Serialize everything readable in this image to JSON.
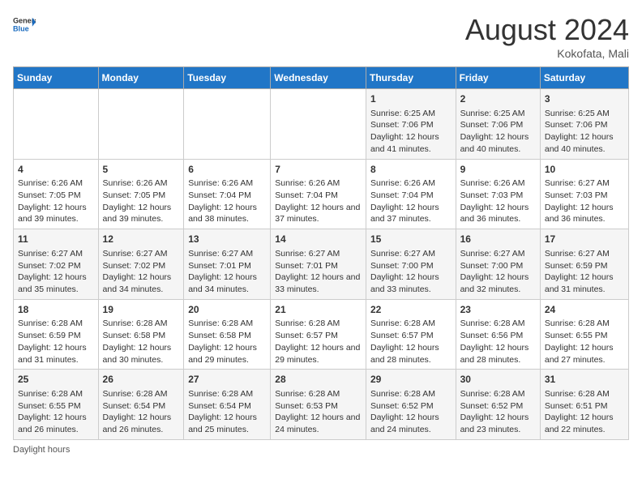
{
  "header": {
    "logo_general": "General",
    "logo_blue": "Blue",
    "month_title": "August 2024",
    "location": "Kokofata, Mali"
  },
  "days_of_week": [
    "Sunday",
    "Monday",
    "Tuesday",
    "Wednesday",
    "Thursday",
    "Friday",
    "Saturday"
  ],
  "weeks": [
    [
      {
        "day": "",
        "info": ""
      },
      {
        "day": "",
        "info": ""
      },
      {
        "day": "",
        "info": ""
      },
      {
        "day": "",
        "info": ""
      },
      {
        "day": "1",
        "info": "Sunrise: 6:25 AM\nSunset: 7:06 PM\nDaylight: 12 hours and 41 minutes."
      },
      {
        "day": "2",
        "info": "Sunrise: 6:25 AM\nSunset: 7:06 PM\nDaylight: 12 hours and 40 minutes."
      },
      {
        "day": "3",
        "info": "Sunrise: 6:25 AM\nSunset: 7:06 PM\nDaylight: 12 hours and 40 minutes."
      }
    ],
    [
      {
        "day": "4",
        "info": "Sunrise: 6:26 AM\nSunset: 7:05 PM\nDaylight: 12 hours and 39 minutes."
      },
      {
        "day": "5",
        "info": "Sunrise: 6:26 AM\nSunset: 7:05 PM\nDaylight: 12 hours and 39 minutes."
      },
      {
        "day": "6",
        "info": "Sunrise: 6:26 AM\nSunset: 7:04 PM\nDaylight: 12 hours and 38 minutes."
      },
      {
        "day": "7",
        "info": "Sunrise: 6:26 AM\nSunset: 7:04 PM\nDaylight: 12 hours and 37 minutes."
      },
      {
        "day": "8",
        "info": "Sunrise: 6:26 AM\nSunset: 7:04 PM\nDaylight: 12 hours and 37 minutes."
      },
      {
        "day": "9",
        "info": "Sunrise: 6:26 AM\nSunset: 7:03 PM\nDaylight: 12 hours and 36 minutes."
      },
      {
        "day": "10",
        "info": "Sunrise: 6:27 AM\nSunset: 7:03 PM\nDaylight: 12 hours and 36 minutes."
      }
    ],
    [
      {
        "day": "11",
        "info": "Sunrise: 6:27 AM\nSunset: 7:02 PM\nDaylight: 12 hours and 35 minutes."
      },
      {
        "day": "12",
        "info": "Sunrise: 6:27 AM\nSunset: 7:02 PM\nDaylight: 12 hours and 34 minutes."
      },
      {
        "day": "13",
        "info": "Sunrise: 6:27 AM\nSunset: 7:01 PM\nDaylight: 12 hours and 34 minutes."
      },
      {
        "day": "14",
        "info": "Sunrise: 6:27 AM\nSunset: 7:01 PM\nDaylight: 12 hours and 33 minutes."
      },
      {
        "day": "15",
        "info": "Sunrise: 6:27 AM\nSunset: 7:00 PM\nDaylight: 12 hours and 33 minutes."
      },
      {
        "day": "16",
        "info": "Sunrise: 6:27 AM\nSunset: 7:00 PM\nDaylight: 12 hours and 32 minutes."
      },
      {
        "day": "17",
        "info": "Sunrise: 6:27 AM\nSunset: 6:59 PM\nDaylight: 12 hours and 31 minutes."
      }
    ],
    [
      {
        "day": "18",
        "info": "Sunrise: 6:28 AM\nSunset: 6:59 PM\nDaylight: 12 hours and 31 minutes."
      },
      {
        "day": "19",
        "info": "Sunrise: 6:28 AM\nSunset: 6:58 PM\nDaylight: 12 hours and 30 minutes."
      },
      {
        "day": "20",
        "info": "Sunrise: 6:28 AM\nSunset: 6:58 PM\nDaylight: 12 hours and 29 minutes."
      },
      {
        "day": "21",
        "info": "Sunrise: 6:28 AM\nSunset: 6:57 PM\nDaylight: 12 hours and 29 minutes."
      },
      {
        "day": "22",
        "info": "Sunrise: 6:28 AM\nSunset: 6:57 PM\nDaylight: 12 hours and 28 minutes."
      },
      {
        "day": "23",
        "info": "Sunrise: 6:28 AM\nSunset: 6:56 PM\nDaylight: 12 hours and 28 minutes."
      },
      {
        "day": "24",
        "info": "Sunrise: 6:28 AM\nSunset: 6:55 PM\nDaylight: 12 hours and 27 minutes."
      }
    ],
    [
      {
        "day": "25",
        "info": "Sunrise: 6:28 AM\nSunset: 6:55 PM\nDaylight: 12 hours and 26 minutes."
      },
      {
        "day": "26",
        "info": "Sunrise: 6:28 AM\nSunset: 6:54 PM\nDaylight: 12 hours and 26 minutes."
      },
      {
        "day": "27",
        "info": "Sunrise: 6:28 AM\nSunset: 6:54 PM\nDaylight: 12 hours and 25 minutes."
      },
      {
        "day": "28",
        "info": "Sunrise: 6:28 AM\nSunset: 6:53 PM\nDaylight: 12 hours and 24 minutes."
      },
      {
        "day": "29",
        "info": "Sunrise: 6:28 AM\nSunset: 6:52 PM\nDaylight: 12 hours and 24 minutes."
      },
      {
        "day": "30",
        "info": "Sunrise: 6:28 AM\nSunset: 6:52 PM\nDaylight: 12 hours and 23 minutes."
      },
      {
        "day": "31",
        "info": "Sunrise: 6:28 AM\nSunset: 6:51 PM\nDaylight: 12 hours and 22 minutes."
      }
    ]
  ],
  "footer": {
    "note": "Daylight hours"
  }
}
